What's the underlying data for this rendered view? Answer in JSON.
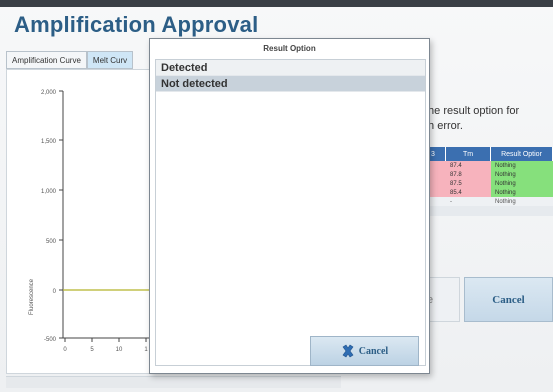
{
  "page": {
    "title": "Amplification Approval"
  },
  "tabs": [
    {
      "label": "Amplification Curve"
    },
    {
      "label": "Melt Curv"
    }
  ],
  "chart": {
    "y_ticks": [
      "2,000",
      "1,500",
      "1,000",
      "500",
      "0",
      "-500"
    ],
    "x_ticks": [
      "0",
      "5",
      "10",
      "1"
    ],
    "ylabel": "Fluorescence",
    "line_color": "#b5b52a"
  },
  "message": {
    "line1": "the result option for",
    "line2": "th error."
  },
  "table": {
    "headers": [
      "3",
      "Tm",
      "Result Optior"
    ],
    "rows": [
      {
        "c1": "",
        "tm": "87.4",
        "result": "Nothing",
        "style": "hl"
      },
      {
        "c1": "",
        "tm": "87.8",
        "result": "Nothing",
        "style": "hl"
      },
      {
        "c1": "",
        "tm": "87.5",
        "result": "Nothing",
        "style": "hl"
      },
      {
        "c1": "",
        "tm": "85.4",
        "result": "Nothing",
        "style": "hl"
      },
      {
        "c1": "0",
        "tm": "-",
        "result": "Nothing",
        "style": "plain"
      }
    ]
  },
  "buttons": {
    "bg_button_label": "e",
    "cancel_label": "Cancel"
  },
  "dialog": {
    "title": "Result Option",
    "options": [
      "Detected",
      "Not detected"
    ],
    "selected_index": 1,
    "cancel_label": "Cancel"
  },
  "colors": {
    "title": "#2c5e86",
    "table_header": "#3b6fb0",
    "tm_highlight": "#f7b3bd",
    "result_highlight": "#86e07c"
  }
}
